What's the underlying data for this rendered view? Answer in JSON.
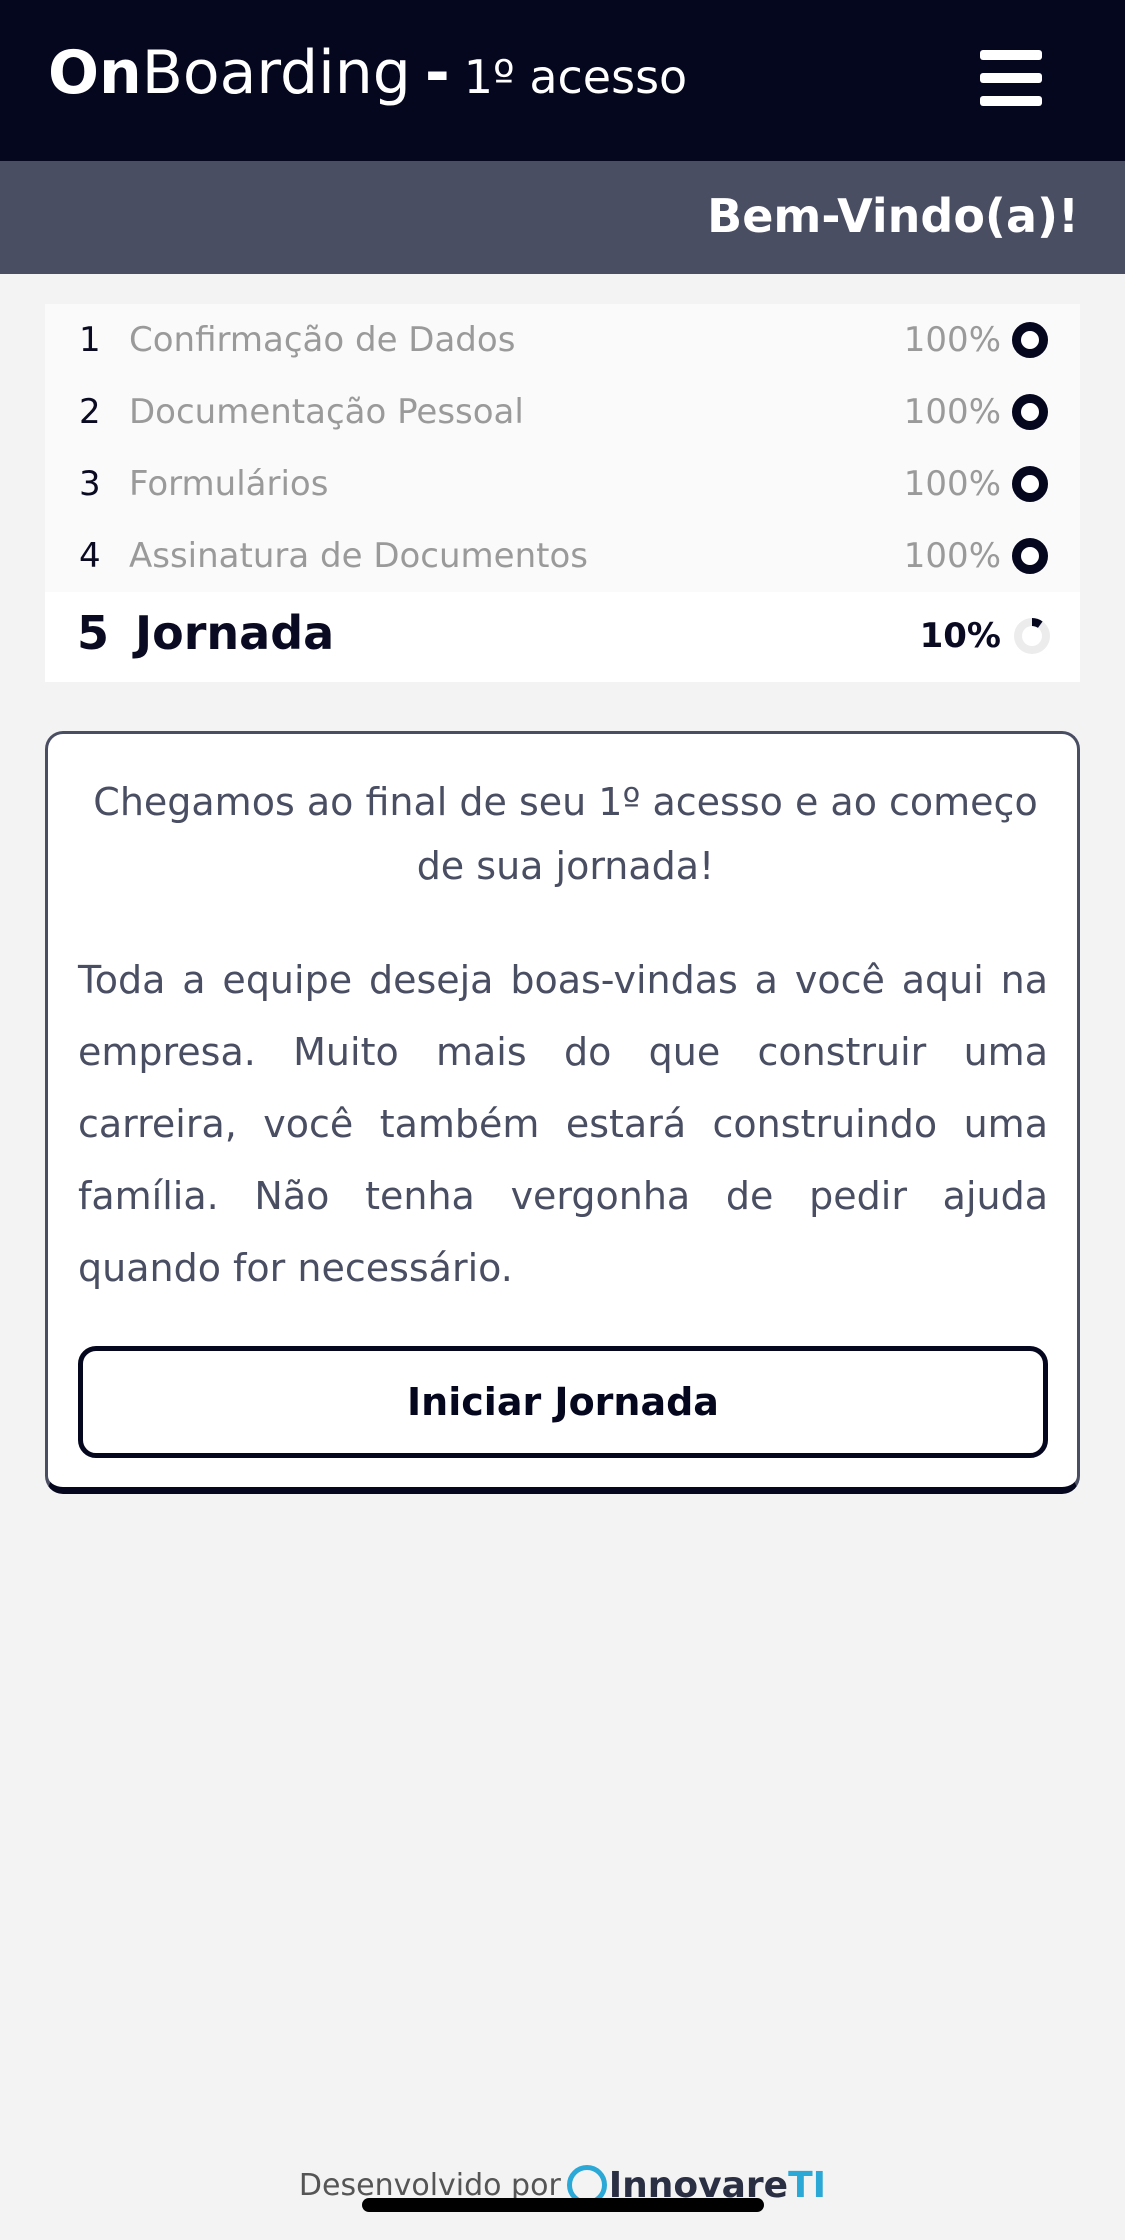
{
  "header": {
    "brand_on": "On",
    "brand_boarding": "Boarding",
    "brand_dash": "-",
    "subtitle": "1º acesso",
    "menu_icon": "hamburger-menu-icon"
  },
  "welcome": {
    "text": "Bem-Vindo(a)!"
  },
  "steps": [
    {
      "num": "1",
      "label": "Confirmação de Dados",
      "percent": "100%",
      "progress": 1.0
    },
    {
      "num": "2",
      "label": "Documentação Pessoal",
      "percent": "100%",
      "progress": 1.0
    },
    {
      "num": "3",
      "label": "Formulários",
      "percent": "100%",
      "progress": 1.0
    },
    {
      "num": "4",
      "label": "Assinatura de Documentos",
      "percent": "100%",
      "progress": 1.0
    },
    {
      "num": "5",
      "label": "Jornada",
      "percent": "10%",
      "progress": 0.1
    }
  ],
  "card": {
    "headline": "Chegamos ao final de seu 1º acesso e ao começo de sua jornada!",
    "body": "Toda a equipe deseja boas-vindas a você aqui na empresa. Muito mais do que construir uma carreira, você também estará construindo uma família. Não tenha vergonha de pedir ajuda quando for necessário.",
    "button_label": "Iniciar Jornada"
  },
  "footer": {
    "developed_by": "Desenvolvido por",
    "logo_name": "Innovare",
    "logo_suffix": "TI"
  },
  "colors": {
    "primary": "#05071f",
    "secondary": "#4a4e63",
    "accent": "#2ba8d6"
  }
}
